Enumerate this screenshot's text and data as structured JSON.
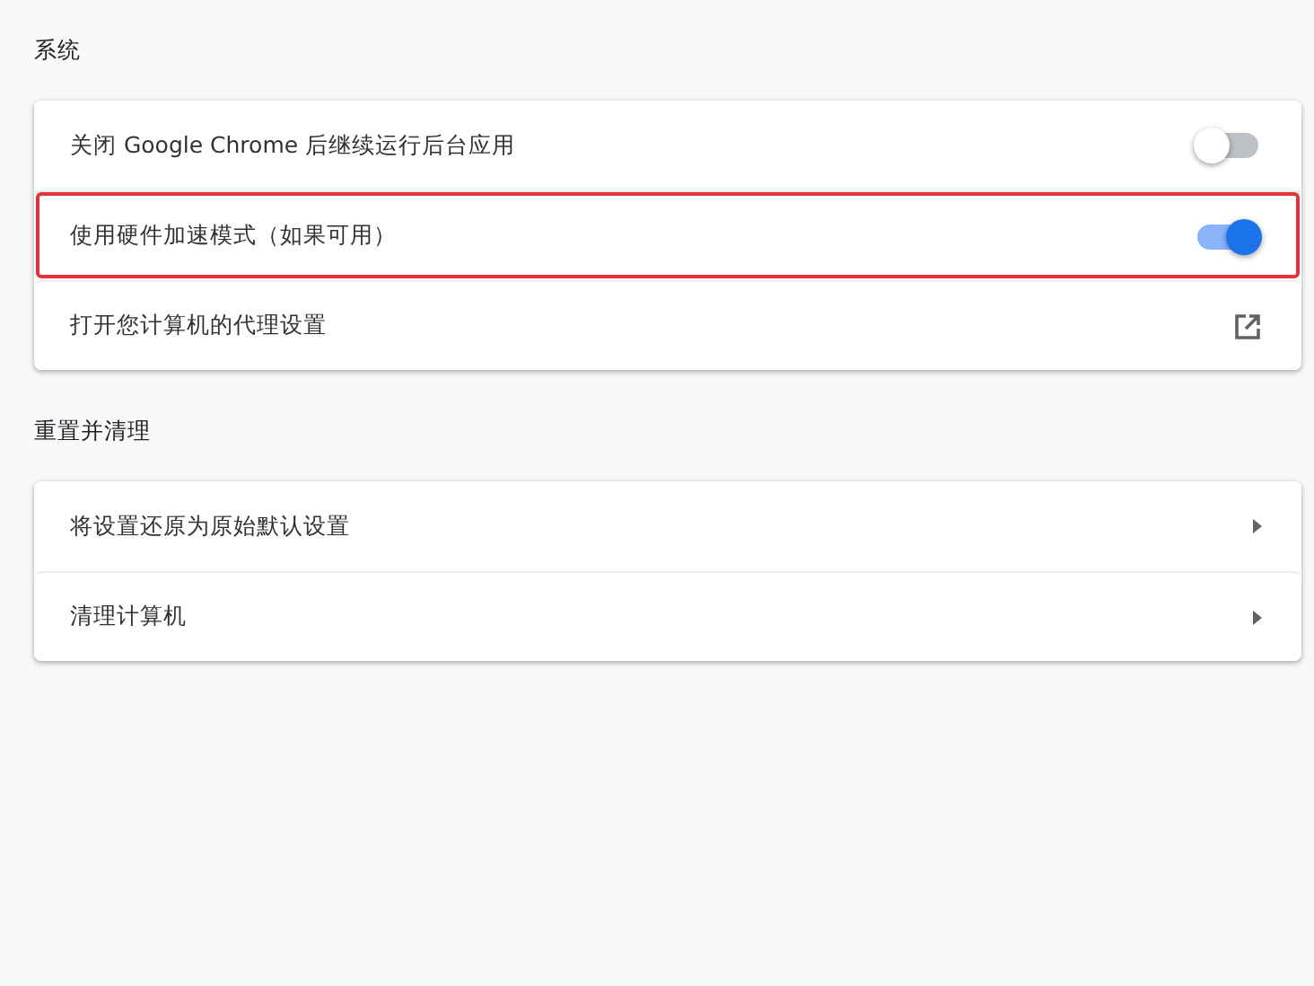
{
  "sections": [
    {
      "title": "系统",
      "items": [
        {
          "kind": "toggle",
          "label": "关闭 Google Chrome 后继续运行后台应用",
          "on": false,
          "highlighted": false
        },
        {
          "kind": "toggle",
          "label": "使用硬件加速模式（如果可用）",
          "on": true,
          "highlighted": true
        },
        {
          "kind": "external",
          "label": "打开您计算机的代理设置",
          "highlighted": false
        }
      ]
    },
    {
      "title": "重置并清理",
      "items": [
        {
          "kind": "arrow",
          "label": "将设置还原为原始默认设置",
          "highlighted": false
        },
        {
          "kind": "arrow",
          "label": "清理计算机",
          "highlighted": false
        }
      ]
    }
  ]
}
